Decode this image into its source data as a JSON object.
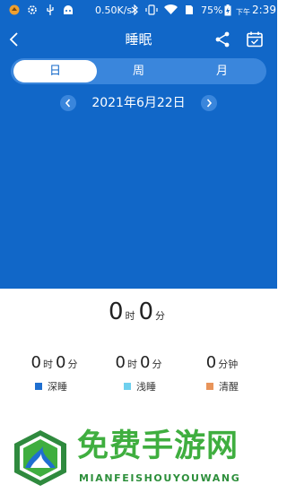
{
  "status_bar": {
    "network_speed": "0.50K/s",
    "battery_percent": "75%",
    "time_prefix": "下午",
    "time": "2:39",
    "icons": [
      "app-notification-icon",
      "settings-notification-icon",
      "usb-icon",
      "android-icon",
      "bluetooth-icon",
      "vibrate-icon",
      "wifi-icon",
      "sim-icon",
      "battery-charging-icon"
    ]
  },
  "header": {
    "title": "睡眠",
    "back_icon": "back-arrow-icon",
    "share_icon": "share-icon",
    "calendar_icon": "calendar-icon"
  },
  "tabs": [
    {
      "label": "日",
      "active": true
    },
    {
      "label": "周",
      "active": false
    },
    {
      "label": "月",
      "active": false
    }
  ],
  "date_nav": {
    "date": "2021年6月22日",
    "prev_icon": "chevron-left-icon",
    "next_icon": "chevron-right-icon"
  },
  "total": {
    "hours": "0",
    "hours_unit": "时",
    "minutes": "0",
    "minutes_unit": "分"
  },
  "stages": [
    {
      "hours": "0",
      "hours_unit": "时",
      "minutes": "0",
      "minutes_unit": "分",
      "label": "深睡",
      "color": "#1f6fd0"
    },
    {
      "hours": "0",
      "hours_unit": "时",
      "minutes": "0",
      "minutes_unit": "分",
      "label": "浅睡",
      "color": "#6fd0ee"
    },
    {
      "value": "0",
      "unit": "分钟",
      "label": "清醒",
      "color": "#e8945a"
    }
  ],
  "watermark": {
    "title": "免费手游网",
    "subtitle": "MIANFEISHOUYOUWANG"
  },
  "colors": {
    "primary": "#1167c8",
    "tab_track": "#3a86dc",
    "watermark_green": "#3fae3f"
  }
}
